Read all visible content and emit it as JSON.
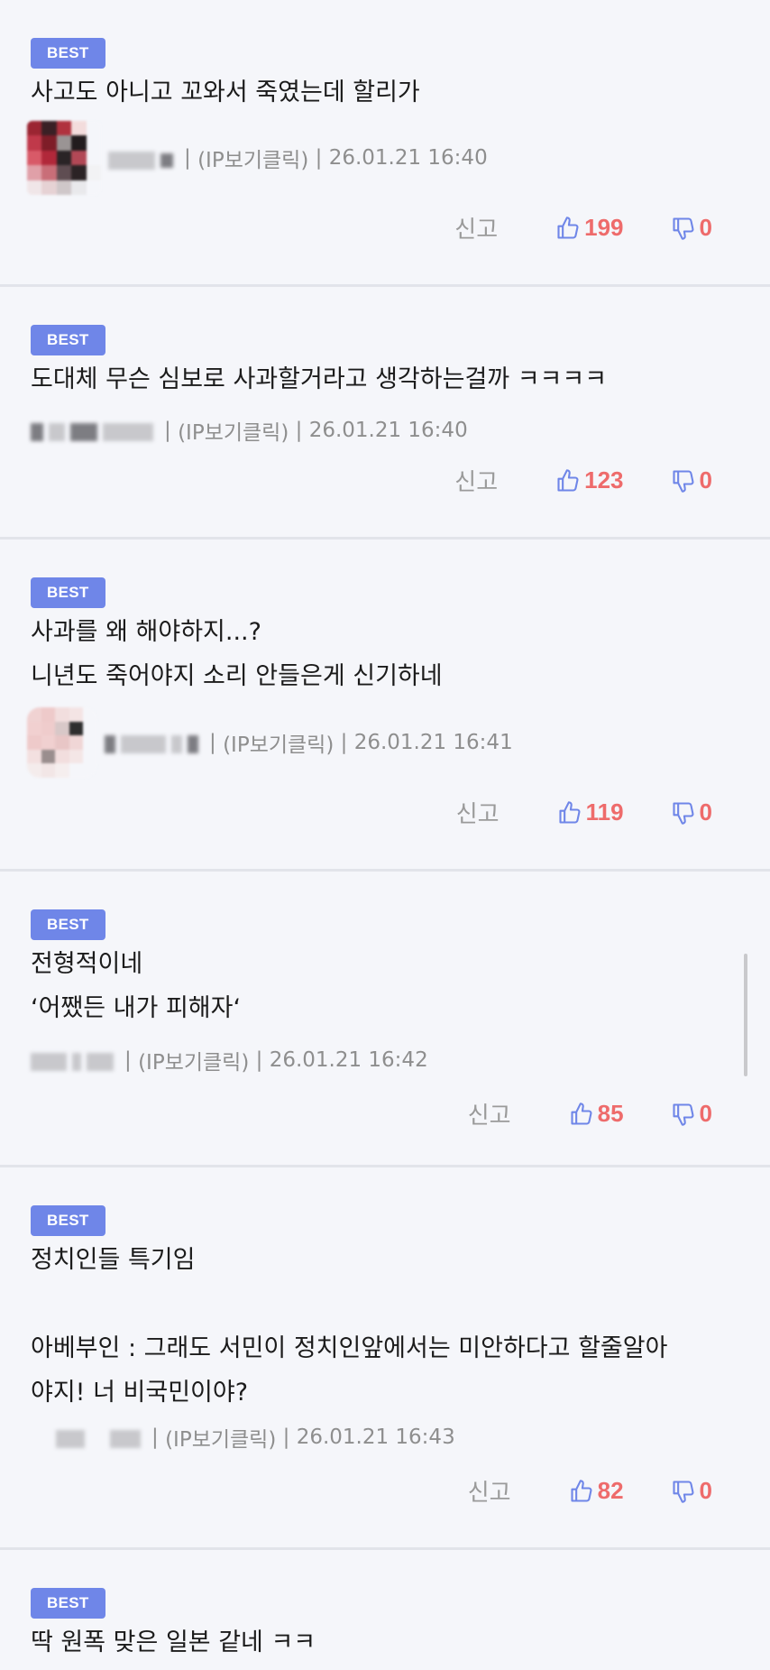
{
  "comments": [
    {
      "badge": "BEST",
      "lines": [
        "사고도 아니고 꼬와서 죽였는데 할리가"
      ],
      "ip_label": "(IP보기클릭)",
      "timestamp": "26.01.21 16:40",
      "report_label": "신고",
      "likes": "199",
      "dislikes": "0"
    },
    {
      "badge": "BEST",
      "lines": [
        "도대체 무슨 심보로 사과할거라고 생각하는걸까 ㅋㅋㅋㅋ"
      ],
      "ip_label": "(IP보기클릭)",
      "timestamp": "26.01.21 16:40",
      "report_label": "신고",
      "likes": "123",
      "dislikes": "0"
    },
    {
      "badge": "BEST",
      "lines": [
        "사과를 왜 해야하지...?",
        "니년도 죽어야지 소리 안들은게 신기하네"
      ],
      "ip_label": "(IP보기클릭)",
      "timestamp": "26.01.21 16:41",
      "report_label": "신고",
      "likes": "119",
      "dislikes": "0"
    },
    {
      "badge": "BEST",
      "lines": [
        "전형적이네",
        "‘어쨌든 내가 피해자‘"
      ],
      "ip_label": "(IP보기클릭)",
      "timestamp": "26.01.21 16:42",
      "report_label": "신고",
      "likes": "85",
      "dislikes": "0"
    },
    {
      "badge": "BEST",
      "lines": [
        "정치인들 특기임",
        "",
        "아베부인 : 그래도 서민이 정치인앞에서는 미안하다고 할줄알아",
        "야지! 너 비국민이야?"
      ],
      "ip_label": "(IP보기클릭)",
      "timestamp": "26.01.21 16:43",
      "report_label": "신고",
      "likes": "82",
      "dislikes": "0"
    },
    {
      "badge": "BEST",
      "lines": [
        "딱 원폭 맞은 일본 같네 ㅋㅋ"
      ]
    }
  ],
  "colors": {
    "badge": "#6f86e8",
    "count": "#ee6b6b",
    "thumb": "#6f86e8",
    "divider": "#e2e4ea"
  },
  "icons": {
    "like": "thumbs-up-icon",
    "dislike": "thumbs-down-icon"
  }
}
